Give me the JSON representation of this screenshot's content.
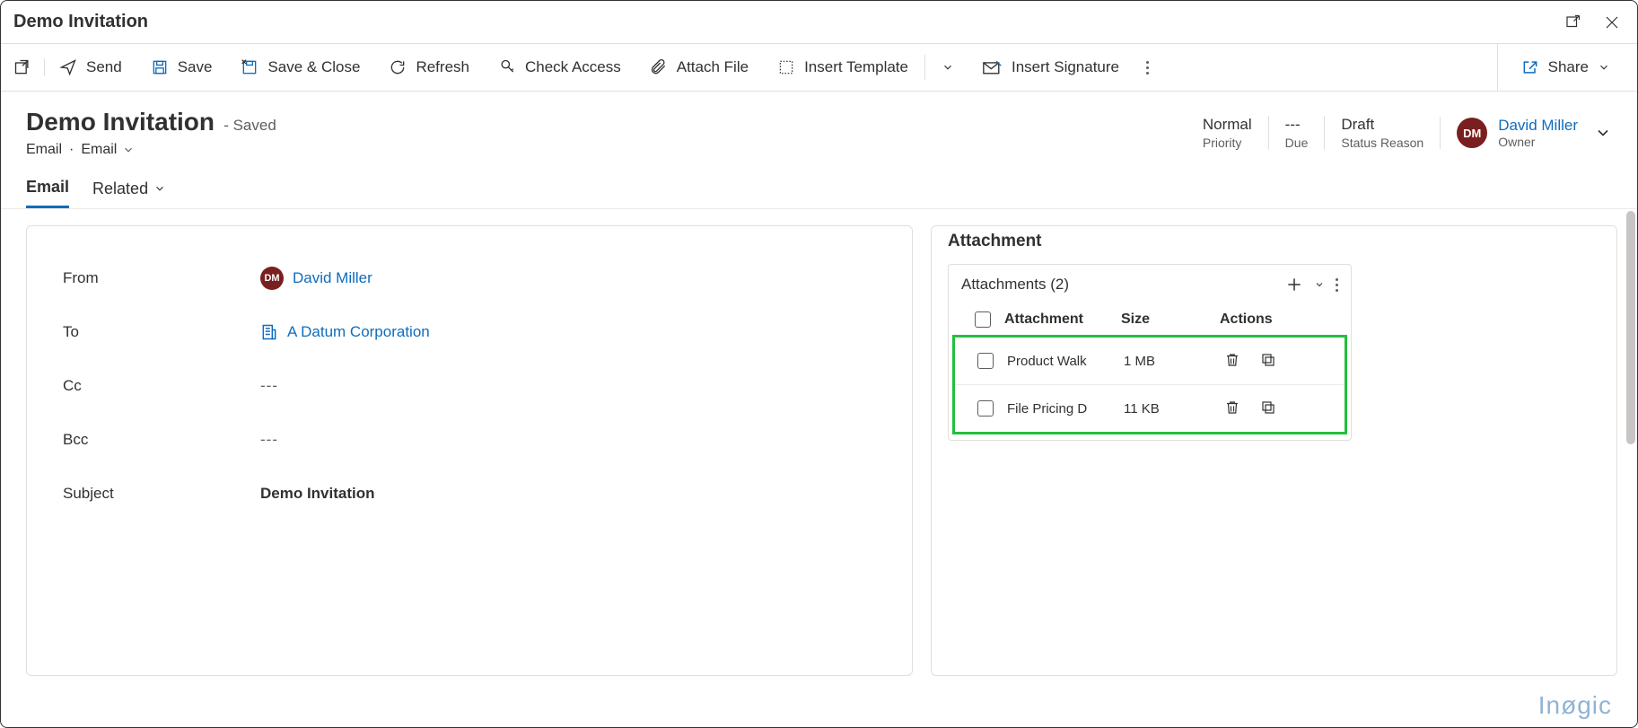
{
  "window": {
    "title": "Demo Invitation"
  },
  "toolbar": {
    "send": "Send",
    "save": "Save",
    "save_close": "Save & Close",
    "refresh": "Refresh",
    "check_access": "Check Access",
    "attach_file": "Attach File",
    "insert_template": "Insert Template",
    "insert_signature": "Insert Signature",
    "share": "Share"
  },
  "header": {
    "title": "Demo Invitation",
    "status": "- Saved",
    "entity": "Email",
    "entity_view": "Email",
    "meta": [
      {
        "value": "Normal",
        "label": "Priority"
      },
      {
        "value": "---",
        "label": "Due"
      },
      {
        "value": "Draft",
        "label": "Status Reason"
      }
    ],
    "owner": {
      "initials": "DM",
      "name": "David Miller",
      "label": "Owner"
    }
  },
  "tabs": {
    "email": "Email",
    "related": "Related"
  },
  "form": {
    "from_label": "From",
    "from_initials": "DM",
    "from_name": "David Miller",
    "to_label": "To",
    "to_name": "A Datum Corporation",
    "cc_label": "Cc",
    "cc_value": "---",
    "bcc_label": "Bcc",
    "bcc_value": "---",
    "subject_label": "Subject",
    "subject_value": "Demo Invitation"
  },
  "attachment_panel": {
    "section_title": "Attachment",
    "grid_title": "Attachments (2)",
    "columns": {
      "name": "Attachment",
      "size": "Size",
      "actions": "Actions"
    },
    "rows": [
      {
        "name": "Product Walk",
        "size": "1 MB"
      },
      {
        "name": "File Pricing D",
        "size": "11 KB"
      }
    ]
  },
  "watermark": "Inøgic"
}
